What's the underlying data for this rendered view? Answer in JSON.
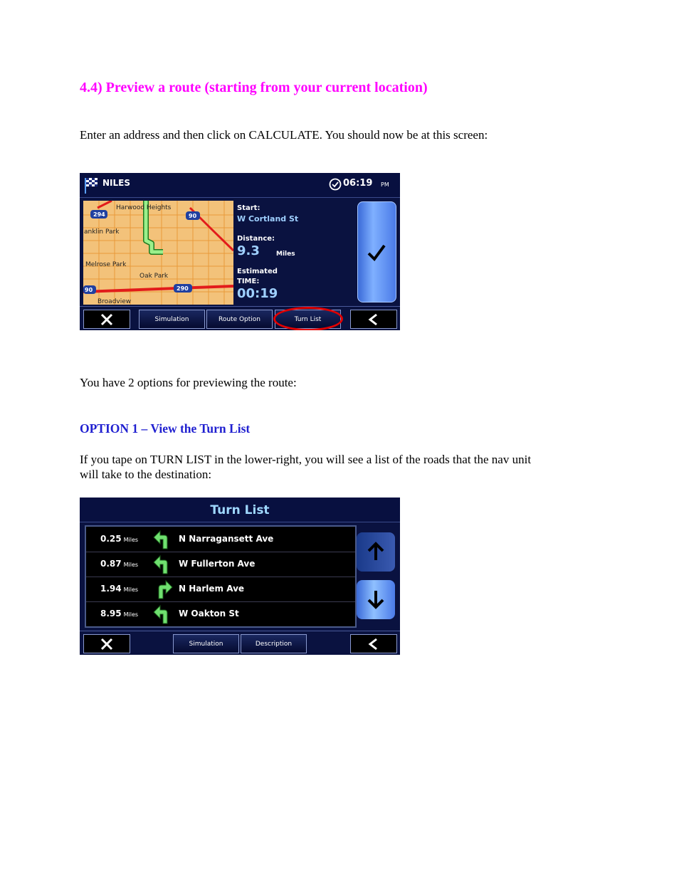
{
  "heading": "4.4)  Preview a route (starting from your current location)",
  "intro": "Enter an address and then click on CALCULATE.  You should now be at this screen:",
  "options_intro": "You have 2 options for previewing the route:",
  "option1_title": "OPTION 1 – View the Turn List",
  "option1_body_line1": "If you tape on TURN LIST in the lower-right, you will see a list of the roads that the nav unit",
  "option1_body_line2": "will take to the destination:",
  "route_screen": {
    "city": "NILES",
    "time": "06:19",
    "ampm": "PM",
    "start_label": "Start:",
    "start_value": "W Cortland  St",
    "distance_label": "Distance:",
    "distance_value": "9.3",
    "distance_unit": "Miles",
    "estimated_label": "Estimated",
    "time_label": "TIME:",
    "time_value": "00:19",
    "map_labels": {
      "harwood": "Harwood Heights",
      "franklin": "anklin Park",
      "melrose": "Melrose Park",
      "oakpark": "Oak Park",
      "broadview": "Broadview",
      "hw294": "294",
      "hw90a": "90",
      "hw90b": "90",
      "hw290": "290"
    },
    "buttons": {
      "simulation": "Simulation",
      "route_option": "Route Option",
      "turn_list": "Turn List"
    }
  },
  "turn_list_screen": {
    "title": "Turn List",
    "rows": [
      {
        "dist": "0.25",
        "unit": "Miles",
        "road": "N Narragansett Ave",
        "dir": "left"
      },
      {
        "dist": "0.87",
        "unit": "Miles",
        "road": "W Fullerton Ave",
        "dir": "left"
      },
      {
        "dist": "1.94",
        "unit": "Miles",
        "road": "N Harlem Ave",
        "dir": "right"
      },
      {
        "dist": "8.95",
        "unit": "Miles",
        "road": "W Oakton  St",
        "dir": "left"
      }
    ],
    "buttons": {
      "simulation": "Simulation",
      "description": "Description"
    }
  },
  "colors": {
    "heading": "#ff00ff",
    "option_title": "#1f1fd0",
    "highlight_ring": "#e00000",
    "turn_arrow": "#6fe06f"
  }
}
